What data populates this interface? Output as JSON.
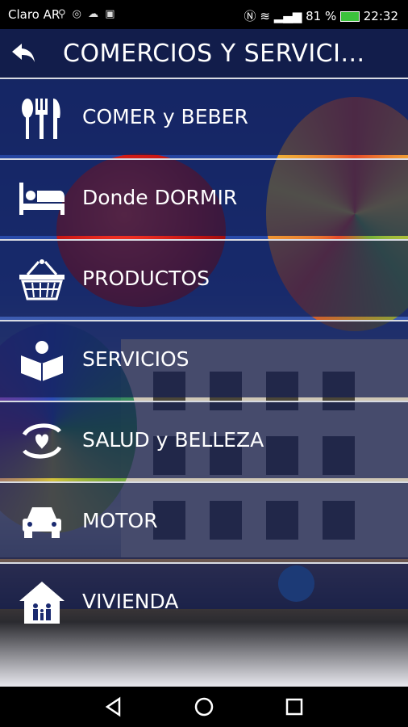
{
  "status_bar": {
    "carrier": "Claro AR",
    "icons": [
      "usb-icon",
      "whatsapp-icon",
      "cloud-icon",
      "app-notification-icon",
      "nfc-icon",
      "wifi-icon",
      "signal-icon",
      "battery-icon"
    ],
    "battery": "81 %",
    "time": "22:32"
  },
  "app_bar": {
    "title": "COMERCIOS Y SERVICI..."
  },
  "menu": {
    "items": [
      {
        "label": "COMER y BEBER",
        "icon": "cutlery-icon"
      },
      {
        "label": "Donde DORMIR",
        "icon": "bed-icon"
      },
      {
        "label": "PRODUCTOS",
        "icon": "basket-icon"
      },
      {
        "label": "SERVICIOS",
        "icon": "open-book-icon"
      },
      {
        "label": "SALUD y BELLEZA",
        "icon": "heart-hands-icon"
      },
      {
        "label": "MOTOR",
        "icon": "car-icon"
      },
      {
        "label": "VIVIENDA",
        "icon": "house-family-icon"
      }
    ]
  },
  "colors": {
    "overlay": "#101c50",
    "appbar": "#121c48",
    "text": "#ffffff"
  }
}
